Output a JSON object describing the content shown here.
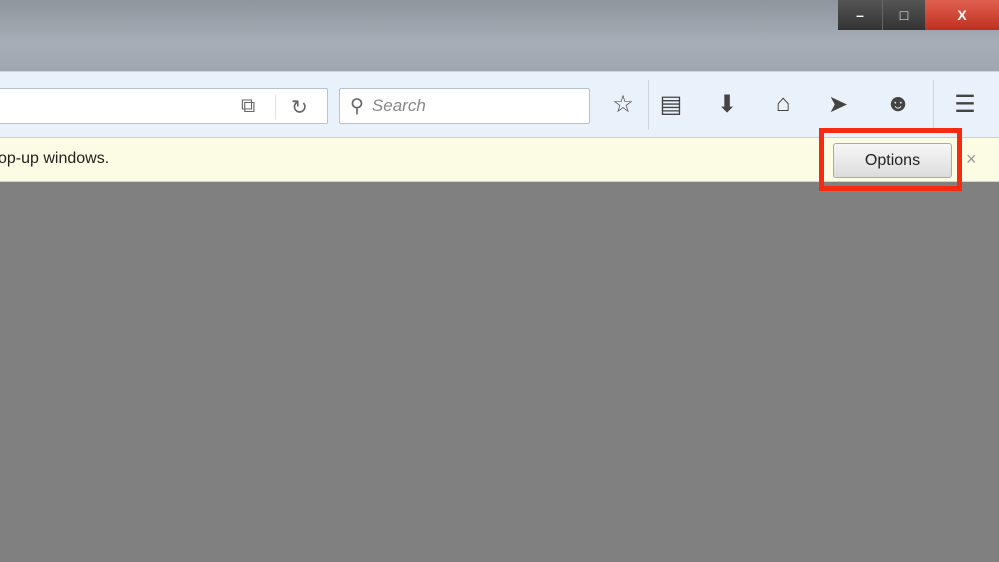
{
  "window_controls": {
    "minimize": "–",
    "maximize": "□",
    "close": "X"
  },
  "urlbar": {
    "identity_icon": "page-block-icon",
    "reload_icon": "reload-icon"
  },
  "search": {
    "placeholder": "Search"
  },
  "toolbar_icons": [
    "star-icon",
    "reading-list-icon",
    "download-icon",
    "home-icon",
    "send-icon",
    "chat-icon",
    "menu-icon"
  ],
  "notification": {
    "message": "op-up windows.",
    "options_label": "Options",
    "close": "×"
  },
  "colors": {
    "highlight": "#f62a10",
    "notification_bg": "#fcfbe3",
    "content_bg": "#808080"
  }
}
